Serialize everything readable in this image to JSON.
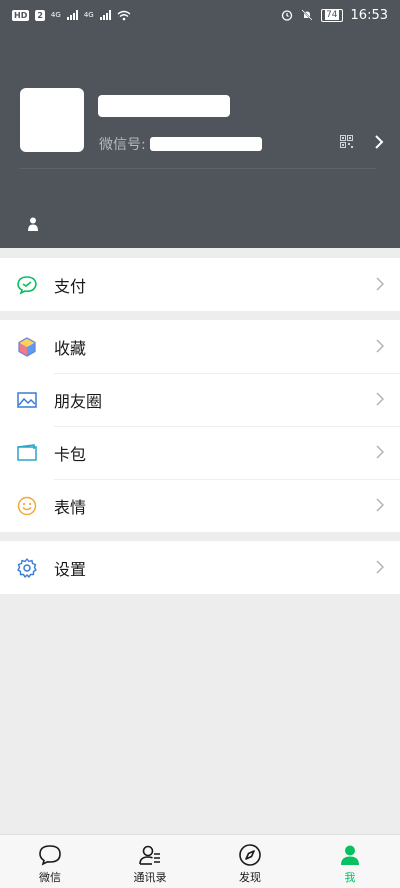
{
  "status_bar": {
    "hd": "HD",
    "sim_badge": "2",
    "net1": "4G",
    "net2": "4G",
    "battery": "74",
    "time": "16:53"
  },
  "profile": {
    "wxid_label": "微信号:"
  },
  "menu": {
    "pay": "支付",
    "favorites": "收藏",
    "moments": "朋友圈",
    "cards": "卡包",
    "stickers": "表情",
    "settings": "设置"
  },
  "tabs": [
    {
      "label": "微信"
    },
    {
      "label": "通讯录"
    },
    {
      "label": "发现"
    },
    {
      "label": "我"
    }
  ],
  "colors": {
    "accent": "#07c160",
    "header_bg": "#50555c"
  }
}
